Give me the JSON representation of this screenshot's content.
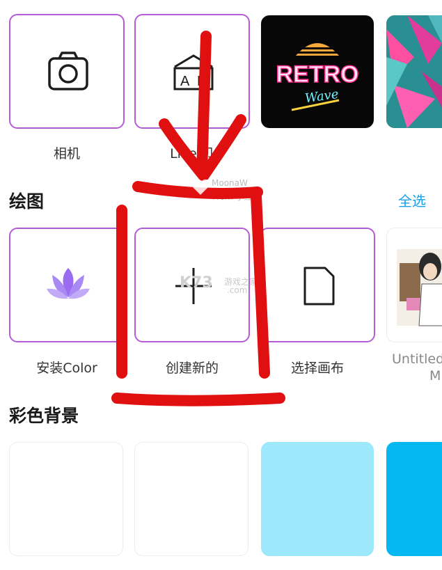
{
  "row1": {
    "camera_label": "相机",
    "ar_label": "Live 贝"
  },
  "retro": {
    "line1": "RETRO",
    "line2": "Wave"
  },
  "drawing": {
    "title": "绘图",
    "select_all": "全选",
    "install_label": "安装Color",
    "create_label": "创建新的",
    "choose_canvas_label": "选择画布",
    "untitled_label_line1": "Untitled",
    "untitled_label_line2": "M"
  },
  "colors_section": {
    "title": "彩色背景"
  },
  "watermarks": {
    "moonaw": "MoonaW",
    "from": "From 小红",
    "k73": "K73",
    "k73_cn": "游戏之家",
    "k73_com": ".com"
  },
  "palette": {
    "selected_border": "#b55ad8",
    "light_blue": "#9de8fb",
    "bright_blue": "#05b8f2",
    "accent_link": "#1aa0e8",
    "annotation_red": "#e01010"
  }
}
